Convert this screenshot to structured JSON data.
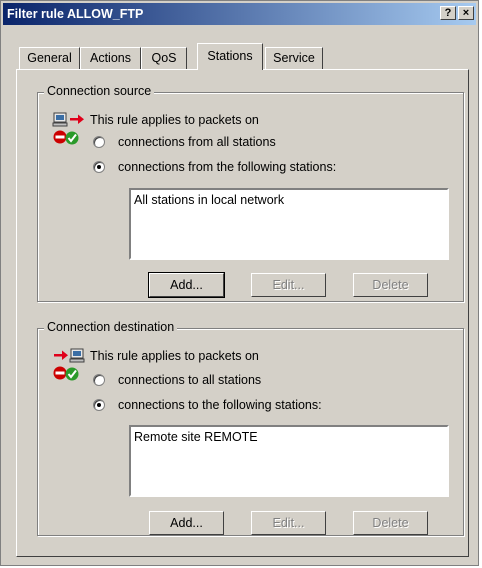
{
  "window": {
    "title": "Filter rule ALLOW_FTP",
    "help_label": "?",
    "close_label": "×"
  },
  "tabs": [
    {
      "label": "General"
    },
    {
      "label": "Actions"
    },
    {
      "label": "QoS"
    },
    {
      "label": "Stations",
      "active": true
    },
    {
      "label": "Service"
    }
  ],
  "source": {
    "group_label": "Connection source",
    "intro": "This rule applies to packets on",
    "option_all": "connections from all stations",
    "option_following": "connections from the following stations:",
    "selected": "following",
    "stations": [
      "All stations in local network"
    ],
    "add_label": "Add...",
    "edit_label": "Edit...",
    "delete_label": "Delete"
  },
  "destination": {
    "group_label": "Connection destination",
    "intro": "This rule applies to packets on",
    "option_all": "connections to all stations",
    "option_following": "connections to the following stations:",
    "selected": "following",
    "stations": [
      "Remote site REMOTE"
    ],
    "add_label": "Add...",
    "edit_label": "Edit...",
    "delete_label": "Delete"
  },
  "colors": {
    "titlebar_start": "#0a246a",
    "titlebar_end": "#a6caf0",
    "face": "#d4d0c8",
    "arrow": "#e0001a",
    "stop": "#cc0000",
    "check": "#2a9a2a"
  }
}
